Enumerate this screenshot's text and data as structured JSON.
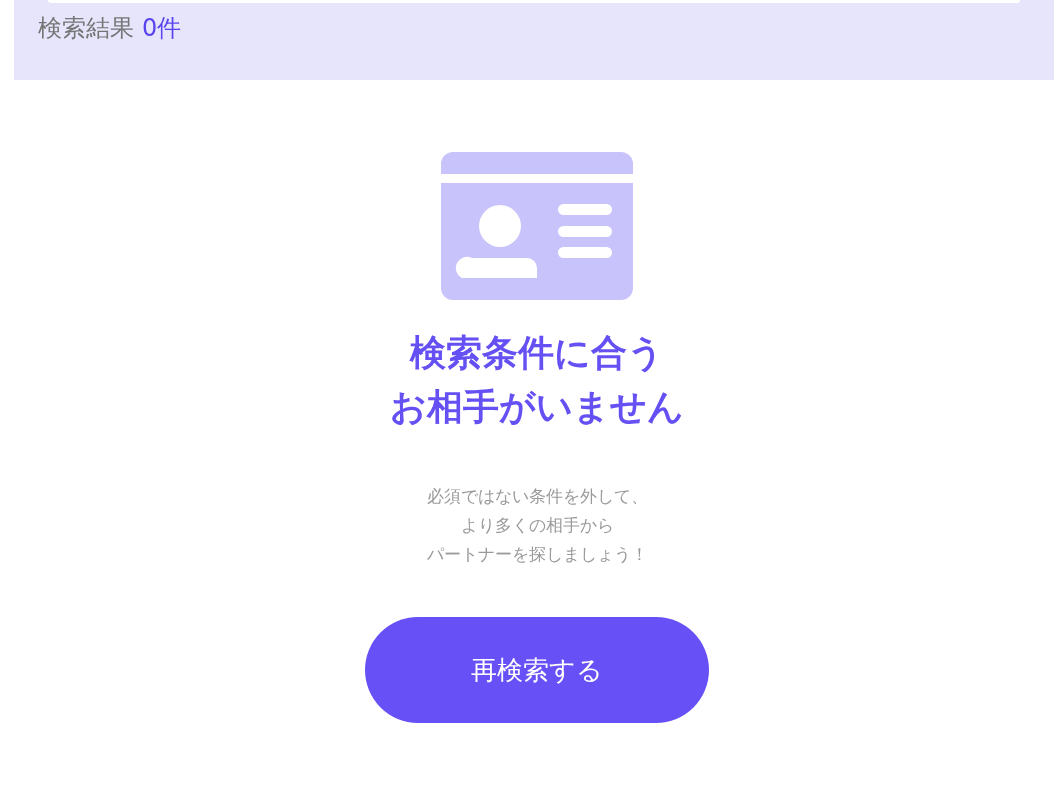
{
  "results_bar": {
    "label": "検索結果",
    "count": "0件"
  },
  "empty_state": {
    "title_lines": [
      "検索条件に合う",
      "お相手がいません"
    ],
    "message_lines": [
      "必須ではない条件を外して、",
      "より多くの相手から",
      "パートナーを探しましょう！"
    ],
    "button": "再検索する"
  }
}
